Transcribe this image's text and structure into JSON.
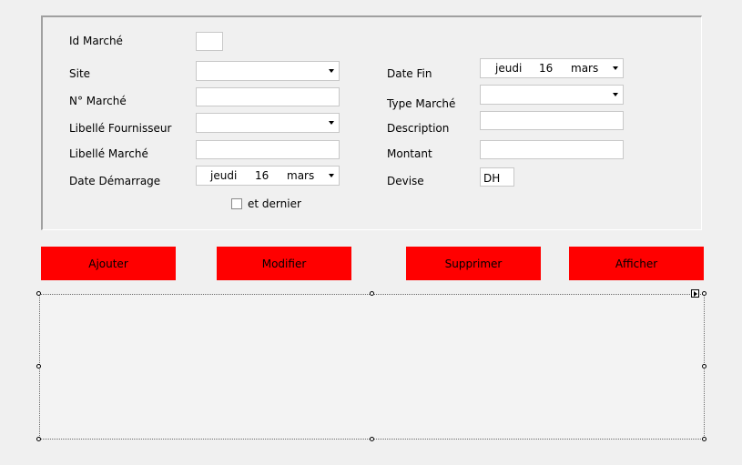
{
  "form": {
    "labels": {
      "id_marche": "Id Marché",
      "site": "Site",
      "n_marche": "N° Marché",
      "libelle_fournisseur": "Libellé Fournisseur",
      "libelle_marche": "Libellé Marché",
      "date_demarrage": "Date Démarrage",
      "date_fin": "Date Fin",
      "type_marche": "Type Marché",
      "description": "Description",
      "montant": "Montant",
      "devise": "Devise"
    },
    "date_demarrage": {
      "day_name": "jeudi",
      "day": "16",
      "month": "mars"
    },
    "date_fin": {
      "day_name": "jeudi",
      "day": "16",
      "month": "mars"
    },
    "devise_value": "DH",
    "checkbox_label": "et dernier"
  },
  "buttons": {
    "ajouter": "Ajouter",
    "modifier": "Modifier",
    "supprimer": "Supprimer",
    "afficher": "Afficher"
  },
  "colors": {
    "button_bg": "#ff0000",
    "window_bg": "#f0f0f0"
  }
}
